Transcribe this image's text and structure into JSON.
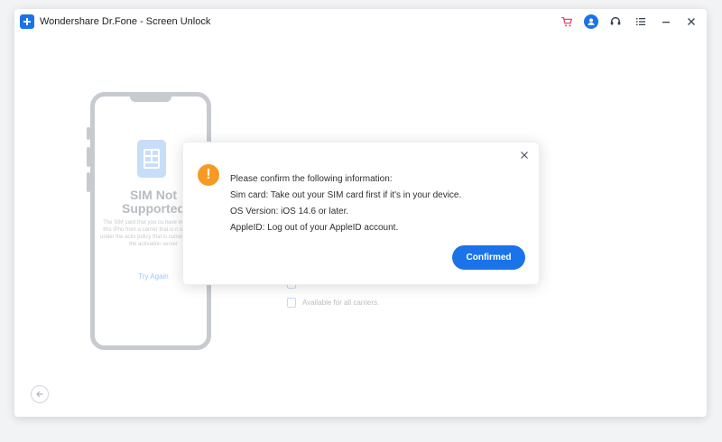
{
  "window": {
    "title": "Wondershare Dr.Fone - Screen Unlock"
  },
  "header": {
    "icons": [
      "cart-icon",
      "user-avatar-icon",
      "headset-icon",
      "menu-icon",
      "minimize-icon",
      "close-icon"
    ]
  },
  "phone": {
    "title": "SIM Not Supported",
    "description": "The SIM card that you cu have installed in this iPho from a carrier that is n supported under the activ policy that is currently ass by the activation server",
    "link": "Try Again"
  },
  "background_rows": [
    {
      "icon": "document-icon"
    },
    {
      "icon": "document-icon",
      "label": "Available for all carriers."
    }
  ],
  "dialog": {
    "lines": [
      "Please confirm the following information:",
      "Sim card: Take out your SIM card first if it's in your device.",
      "OS Version: iOS 14.6 or later.",
      "AppleID: Log out of your AppleID account."
    ],
    "confirm_label": "Confirmed"
  },
  "colors": {
    "accent": "#1a73e8",
    "warning": "#f59a23",
    "cart": "#e8456b"
  }
}
